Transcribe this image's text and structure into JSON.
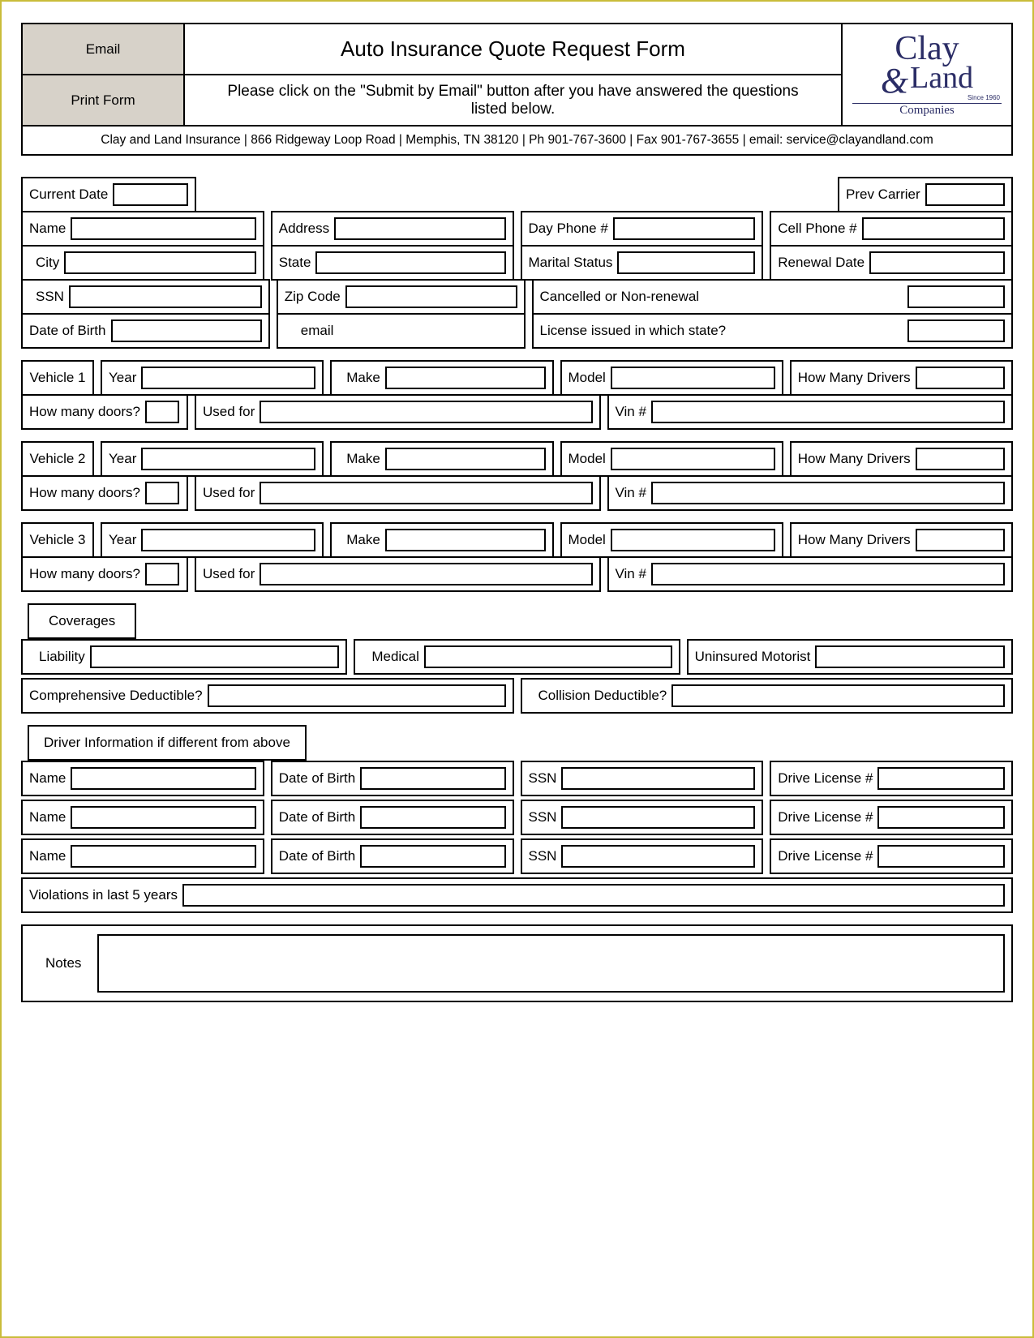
{
  "header": {
    "email_btn": "Email",
    "print_btn": "Print Form",
    "title": "Auto Insurance Quote Request Form",
    "subtitle": "Please click on the \"Submit by Email\" button after you have answered the questions listed below.",
    "logo_line1": "Clay",
    "logo_line2": "Land",
    "logo_amp": "&",
    "logo_since": "Since 1960",
    "logo_sub": "Companies",
    "contact": "Clay and Land Insurance | 866 Ridgeway Loop Road | Memphis, TN 38120 | Ph 901-767-3600 | Fax 901-767-3655 | email: service@clayandland.com"
  },
  "top": {
    "current_date": "Current Date",
    "prev_carrier": "Prev Carrier",
    "name": "Name",
    "address": "Address",
    "day_phone": "Day Phone #",
    "cell_phone": "Cell Phone #",
    "city": "City",
    "state": "State",
    "marital": "Marital Status",
    "renewal": "Renewal Date",
    "ssn": "SSN",
    "zip": "Zip Code",
    "cancelled": "Cancelled or Non-renewal",
    "dob": "Date of Birth",
    "email": "email",
    "license_state": "License issued in which state?"
  },
  "vehicle_labels": {
    "year": "Year",
    "make": "Make",
    "model": "Model",
    "drivers": "How Many Drivers",
    "doors": "How many doors?",
    "used": "Used for",
    "vin": "Vin #"
  },
  "vehicles": [
    "Vehicle 1",
    "Vehicle 2",
    "Vehicle 3"
  ],
  "coverages": {
    "title": "Coverages",
    "liability": "Liability",
    "medical": "Medical",
    "uninsured": "Uninsured Motorist",
    "comp": "Comprehensive Deductible?",
    "collision": "Collision Deductible?"
  },
  "drivers": {
    "title": "Driver Information if different from above",
    "name": "Name",
    "dob": "Date of Birth",
    "ssn": "SSN",
    "license": "Drive License #",
    "violations": "Violations in last 5 years"
  },
  "notes_label": "Notes"
}
